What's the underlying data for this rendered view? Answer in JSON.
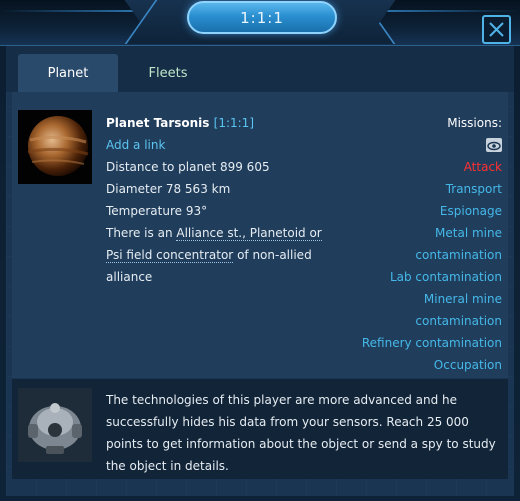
{
  "window": {
    "title": "1:1:1"
  },
  "tabs": [
    {
      "label": "Planet",
      "active": true
    },
    {
      "label": "Fleets",
      "active": false
    }
  ],
  "planet": {
    "name": "Planet Tarsonis",
    "coords": "[1:1:1]",
    "add_link": "Add a link",
    "distance": "Distance to planet 899 605",
    "diameter": "Diameter 78 563 km",
    "temperature": "Temperature 93°",
    "alliance_prefix": "There is an",
    "alliance_link_1": "Alliance st., Planetoid or",
    "alliance_link_2": "Psi field concentrator",
    "alliance_suffix": " of non-allied",
    "alliance_end": "alliance"
  },
  "missions": {
    "title": "Missions:",
    "items": [
      "Attack",
      "Transport",
      "Espionage",
      "Metal mine",
      "contamination",
      "Lab contamination",
      "Mineral mine",
      "contamination",
      "Refinery contamination",
      "Occupation"
    ],
    "view_icon": "eye-icon"
  },
  "notice": {
    "line1": "The technologies of this player are more advanced and he",
    "line2": "successfully hides his data from your sensors. Reach 25 000",
    "line3": "points to get information about the object or send a spy to study",
    "line4": "the object in details."
  },
  "colors": {
    "accent": "#5bc4f0",
    "attack": "#ff3030",
    "tab_inactive_text": "#bfe6c8"
  }
}
